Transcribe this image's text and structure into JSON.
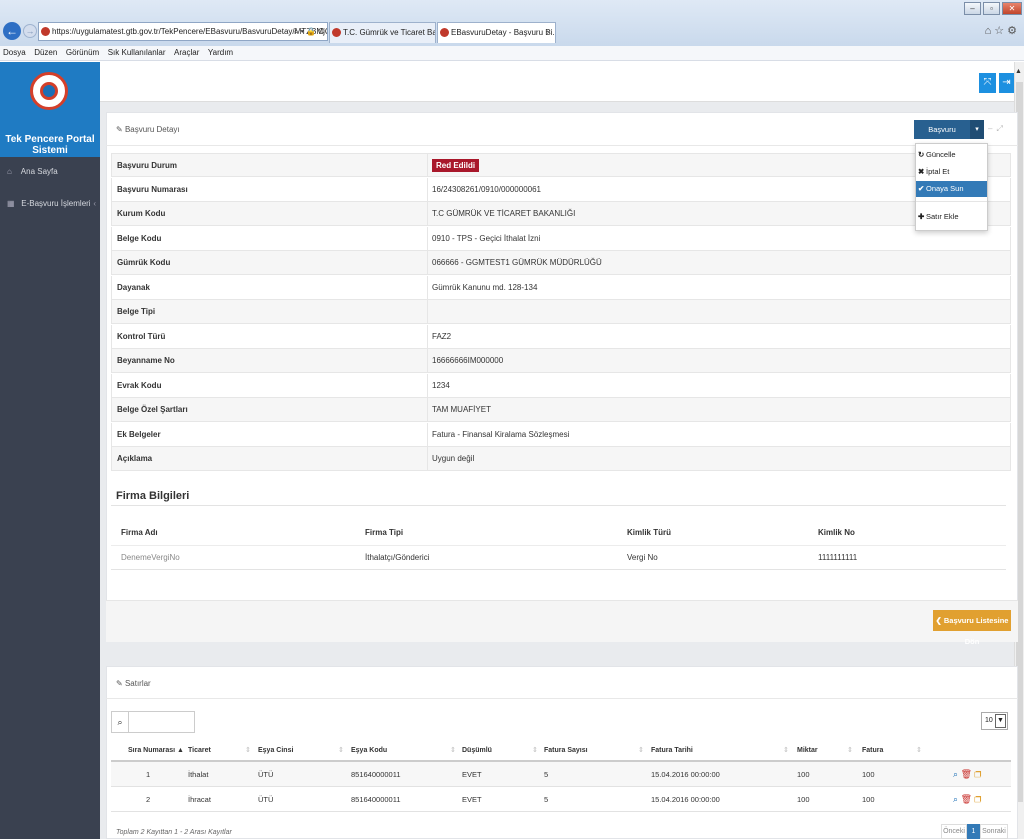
{
  "browser": {
    "url": "https://uygulamatest.gtb.gov.tr/TekPencere/EBasvuru/BasvuruDetay/MTZBMjQzMD",
    "url_controls": "⌕ ▾ 🔒 C",
    "tabs": [
      {
        "label": "T.C. Gümrük ve Ticaret Bakanl..."
      },
      {
        "label": "EBasvuruDetay - Başvuru Bi..."
      }
    ],
    "tab_close": "×",
    "window_buttons": [
      "–",
      "▫",
      "✕"
    ],
    "toolbar_icons": "⌂☆⚙"
  },
  "menubar": [
    "Dosya",
    "Düzen",
    "Görünüm",
    "Sık Kullanılanlar",
    "Araçlar",
    "Yardım"
  ],
  "sidebar": {
    "portal_title": "Tek Pencere Portal Sistemi",
    "items": [
      {
        "label": "Ana Sayfa",
        "icon": "home-icon"
      },
      {
        "label": "E-Başvuru İşlemleri",
        "icon": "chart-icon"
      }
    ]
  },
  "detail_panel": {
    "title": "Başvuru Detayı",
    "actions_button": "Başvuru İşlemleri",
    "dropdown": [
      "Güncelle",
      "İptal Et",
      "Onaya Sun",
      "Satır Ekle"
    ],
    "rows": [
      {
        "label": "Başvuru Durum",
        "value": "Red Edildi"
      },
      {
        "label": "Başvuru Numarası",
        "value": "16/24308261/0910/000000061"
      },
      {
        "label": "Kurum Kodu",
        "value": "T.C GÜMRÜK VE TİCARET BAKANLIĞI"
      },
      {
        "label": "Belge Kodu",
        "value": "0910 - TPS - Geçici İthalat İzni"
      },
      {
        "label": "Gümrük Kodu",
        "value": "066666 - GGMTEST1 GÜMRÜK MÜDÜRLÜĞÜ"
      },
      {
        "label": "Dayanak",
        "value": "Gümrük Kanunu md. 128-134"
      },
      {
        "label": "Belge Tipi",
        "value": ""
      },
      {
        "label": "Kontrol Türü",
        "value": "FAZ2"
      },
      {
        "label": "Beyanname No",
        "value": "16666666IM000000"
      },
      {
        "label": "Evrak Kodu",
        "value": "1234"
      },
      {
        "label": "Belge Özel Şartları",
        "value": "TAM MUAFİYET"
      },
      {
        "label": "Ek Belgeler",
        "value": "Fatura - Finansal Kiralama Sözleşmesi"
      },
      {
        "label": "Açıklama",
        "value": "Uygun değil"
      }
    ],
    "firma": {
      "title": "Firma Bilgileri",
      "columns": [
        "Firma Adı",
        "Firma Tipi",
        "Kimlik Türü",
        "Kimlik No"
      ],
      "row": [
        "DenemeVergiNo",
        "İthalatçı/Gönderici",
        "Vergi No",
        "1111111111"
      ]
    },
    "back_button": "Başvuru Listesine Dön"
  },
  "lines_panel": {
    "title": "Satırlar",
    "page_size": "10",
    "columns": [
      "Sıra Numarası",
      "Ticaret",
      "Eşya Cinsi",
      "Eşya Kodu",
      "Düşümlü",
      "Fatura Sayısı",
      "Fatura Tarihi",
      "Miktar",
      "Fatura"
    ],
    "rows": [
      [
        "1",
        "İthalat",
        "ÜTÜ",
        "851640000011",
        "EVET",
        "5",
        "15.04.2016 00:00:00",
        "100",
        "100"
      ],
      [
        "2",
        "İhracat",
        "ÜTÜ",
        "851640000011",
        "EVET",
        "5",
        "15.04.2016 00:00:00",
        "100",
        "100"
      ]
    ],
    "footer": "Toplam 2 Kayıttan 1 - 2 Arası Kayıtlar",
    "pagination": {
      "prev": "Önceki",
      "current": "1",
      "next": "Sonraki"
    }
  },
  "colors": {
    "brand_blue": "#1f7bc3",
    "sidebar": "#3a4150",
    "danger": "#a9182b",
    "warning": "#e1a030",
    "primary": "#286090"
  }
}
